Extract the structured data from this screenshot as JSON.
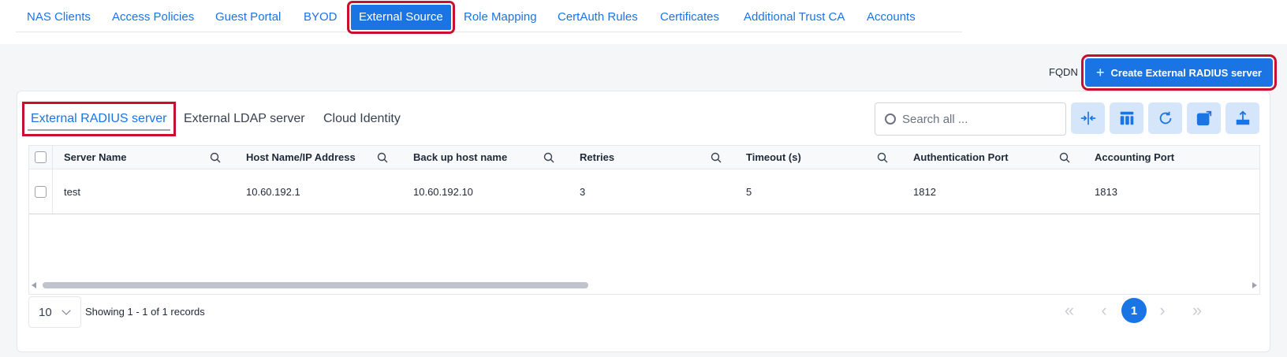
{
  "top_nav": [
    {
      "label": "NAS Clients",
      "active": false
    },
    {
      "label": "Access Policies",
      "active": false
    },
    {
      "label": "Guest Portal",
      "active": false
    },
    {
      "label": "BYOD",
      "active": false
    },
    {
      "label": "External Source",
      "active": true
    },
    {
      "label": "Role Mapping",
      "active": false
    },
    {
      "label": "CertAuth Rules",
      "active": false
    },
    {
      "label": "Certificates",
      "active": false
    },
    {
      "label": "Additional Trust CA",
      "active": false
    },
    {
      "label": "Accounts",
      "active": false
    }
  ],
  "header": {
    "fqdn_label": "FQDN",
    "create_button_label": "Create External RADIUS server",
    "create_button_icon": "plus-icon"
  },
  "sub_tabs": [
    {
      "label": "External RADIUS server",
      "active": true
    },
    {
      "label": "External LDAP server",
      "active": false
    },
    {
      "label": "Cloud Identity",
      "active": false
    }
  ],
  "search": {
    "placeholder": "Search all ..."
  },
  "toolbar": {
    "icons": [
      "collapse-columns-icon",
      "column-layout-icon",
      "refresh-icon",
      "open-external-icon",
      "export-icon"
    ]
  },
  "table": {
    "columns": [
      "Server Name",
      "Host Name/IP Address",
      "Back up host name",
      "Retries",
      "Timeout (s)",
      "Authentication Port",
      "Accounting Port"
    ],
    "rows": [
      [
        "test",
        "10.60.192.1",
        "10.60.192.10",
        "3",
        "5",
        "1812",
        "1813"
      ]
    ]
  },
  "footer": {
    "page_size": "10",
    "records_text": "Showing 1 - 1 of 1 records",
    "current_page": "1"
  },
  "colors": {
    "accent": "#1b74e4",
    "highlight_outline": "#c8102e",
    "tool_button_bg": "#d5e6fb"
  }
}
